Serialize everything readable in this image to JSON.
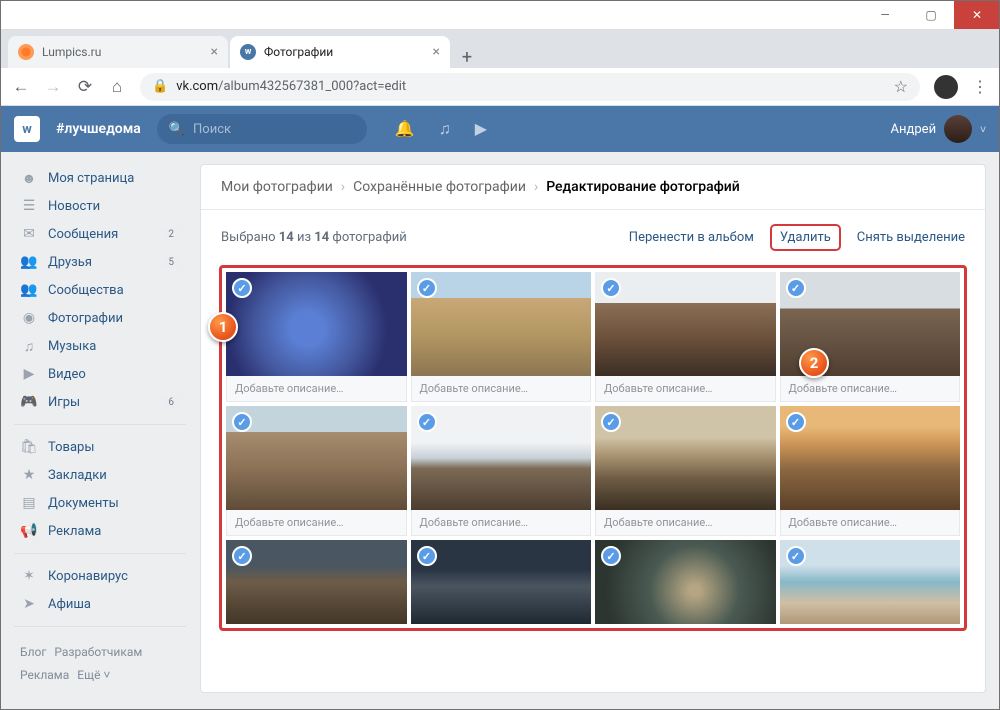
{
  "tabs": [
    {
      "title": "Lumpics.ru"
    },
    {
      "title": "Фотографии"
    }
  ],
  "url_domain": "vk.com",
  "url_path": "/album432567381_000?act=edit",
  "vk": {
    "hashtag": "#лучшедома",
    "search_placeholder": "Поиск",
    "username": "Андрей"
  },
  "sidebar": {
    "items": [
      {
        "icon": "☻",
        "label": "Моя страница"
      },
      {
        "icon": "☰",
        "label": "Новости"
      },
      {
        "icon": "✉",
        "label": "Сообщения",
        "badge": "2"
      },
      {
        "icon": "👥",
        "label": "Друзья",
        "badge": "5"
      },
      {
        "icon": "👥",
        "label": "Сообщества"
      },
      {
        "icon": "◉",
        "label": "Фотографии"
      },
      {
        "icon": "♫",
        "label": "Музыка"
      },
      {
        "icon": "▶",
        "label": "Видео"
      },
      {
        "icon": "🎮",
        "label": "Игры",
        "badge": "6"
      }
    ],
    "items2": [
      {
        "icon": "🛍",
        "label": "Товары"
      },
      {
        "icon": "★",
        "label": "Закладки"
      },
      {
        "icon": "▤",
        "label": "Документы"
      },
      {
        "icon": "📢",
        "label": "Реклама"
      }
    ],
    "items3": [
      {
        "icon": "✶",
        "label": "Коронавирус"
      },
      {
        "icon": "➤",
        "label": "Афиша"
      }
    ],
    "footer": [
      "Блог",
      "Разработчикам",
      "Реклама",
      "Ещё ˅"
    ]
  },
  "crumbs": {
    "a": "Мои фотографии",
    "b": "Сохранённые фотографии",
    "c": "Редактирование фотографий"
  },
  "selection": {
    "text_a": "Выбрано ",
    "sel": "14",
    "text_b": " из ",
    "total": "14",
    "text_c": " фотографий",
    "move": "Перенести в альбом",
    "delete": "Удалить",
    "deselect": "Снять выделение"
  },
  "desc_placeholder": "Добавьте описание…"
}
